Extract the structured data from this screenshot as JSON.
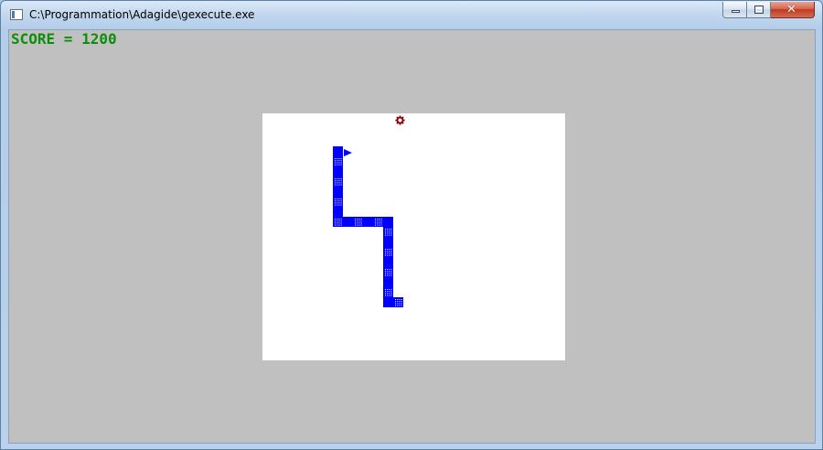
{
  "window": {
    "title": "C:\\Programmation\\Adagide\\gexecute.exe",
    "controls": {
      "minimize_icon": "minimize-icon",
      "maximize_icon": "maximize-icon",
      "close_icon": "close-icon",
      "close_label": "✕"
    }
  },
  "game": {
    "score_text": "SCORE = 1200",
    "colors": {
      "background": "#c0c0c0",
      "board": "#ffffff",
      "snake": "#0000ff",
      "score": "#0b8f0b",
      "food": "#8b0000"
    },
    "grid": {
      "cols": 30,
      "rows": 24
    },
    "food": {
      "col": 13,
      "row": 0
    },
    "snake": {
      "head_direction": "right",
      "segments": [
        {
          "col": 7,
          "row": 3
        },
        {
          "col": 7,
          "row": 4
        },
        {
          "col": 7,
          "row": 5
        },
        {
          "col": 7,
          "row": 6
        },
        {
          "col": 7,
          "row": 7
        },
        {
          "col": 7,
          "row": 8
        },
        {
          "col": 7,
          "row": 9
        },
        {
          "col": 7,
          "row": 10
        },
        {
          "col": 8,
          "row": 10
        },
        {
          "col": 9,
          "row": 10
        },
        {
          "col": 10,
          "row": 10
        },
        {
          "col": 11,
          "row": 10
        },
        {
          "col": 12,
          "row": 10
        },
        {
          "col": 12,
          "row": 11
        },
        {
          "col": 12,
          "row": 12
        },
        {
          "col": 12,
          "row": 13
        },
        {
          "col": 12,
          "row": 14
        },
        {
          "col": 12,
          "row": 15
        },
        {
          "col": 12,
          "row": 16
        },
        {
          "col": 12,
          "row": 17
        },
        {
          "col": 12,
          "row": 18
        },
        {
          "col": 13,
          "row": 18
        }
      ]
    }
  }
}
